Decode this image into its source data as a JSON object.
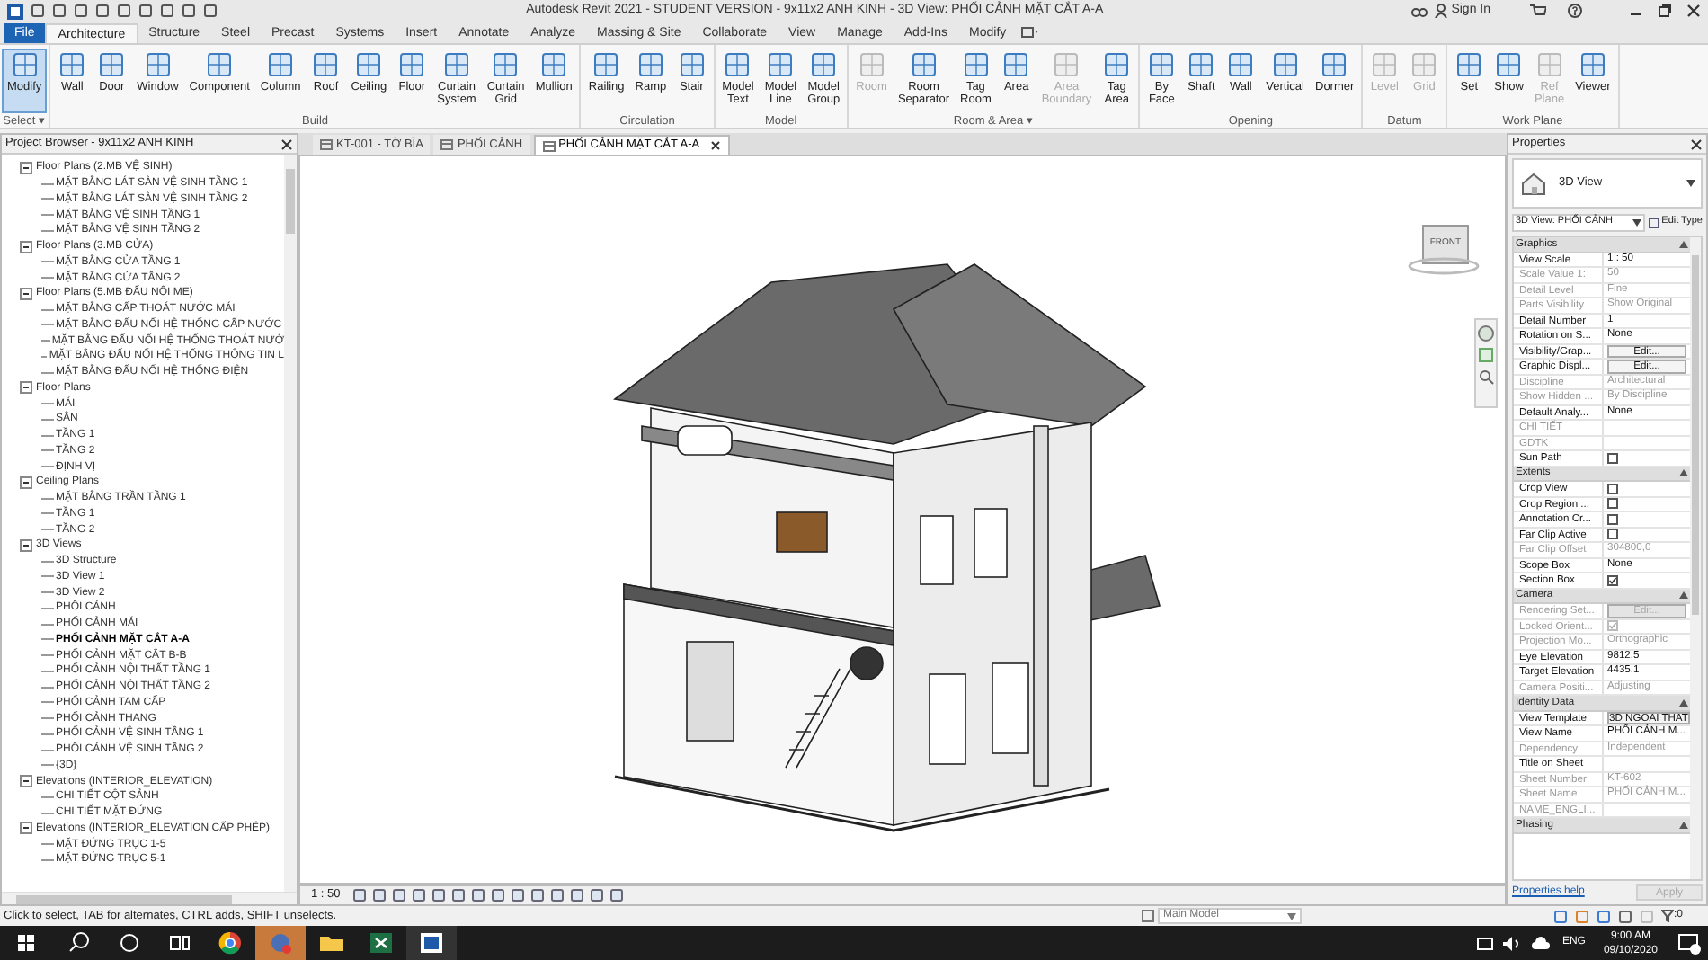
{
  "title_bar": {
    "title": "Autodesk Revit 2021 - STUDENT VERSION - 9x11x2 ANH KINH - 3D View: PHỐI CẢNH MẶT CẮT A-A",
    "sign_in": "Sign In"
  },
  "ribbon_tabs": [
    {
      "label": "File",
      "kind": "file",
      "selected": false
    },
    {
      "label": "Architecture",
      "kind": "tab",
      "selected": true
    },
    {
      "label": "Structure",
      "kind": "tab",
      "selected": false
    },
    {
      "label": "Steel",
      "kind": "tab",
      "selected": false
    },
    {
      "label": "Precast",
      "kind": "tab",
      "selected": false
    },
    {
      "label": "Systems",
      "kind": "tab",
      "selected": false
    },
    {
      "label": "Insert",
      "kind": "tab",
      "selected": false
    },
    {
      "label": "Annotate",
      "kind": "tab",
      "selected": false
    },
    {
      "label": "Analyze",
      "kind": "tab",
      "selected": false
    },
    {
      "label": "Massing & Site",
      "kind": "tab",
      "selected": false
    },
    {
      "label": "Collaborate",
      "kind": "tab",
      "selected": false
    },
    {
      "label": "View",
      "kind": "tab",
      "selected": false
    },
    {
      "label": "Manage",
      "kind": "tab",
      "selected": false
    },
    {
      "label": "Add-Ins",
      "kind": "tab",
      "selected": false
    },
    {
      "label": "Modify",
      "kind": "tab",
      "selected": false
    }
  ],
  "ribbon_panels": [
    {
      "label": "Select ▾",
      "tools": [
        {
          "label": "Modify",
          "selected": true,
          "disabled": false
        }
      ]
    },
    {
      "label": "Build",
      "tools": [
        {
          "label": "Wall",
          "selected": false,
          "disabled": false
        },
        {
          "label": "Door",
          "selected": false,
          "disabled": false
        },
        {
          "label": "Window",
          "selected": false,
          "disabled": false
        },
        {
          "label": "Component",
          "selected": false,
          "disabled": false
        },
        {
          "label": "Column",
          "selected": false,
          "disabled": false
        },
        {
          "label": "Roof",
          "selected": false,
          "disabled": false
        },
        {
          "label": "Ceiling",
          "selected": false,
          "disabled": false
        },
        {
          "label": "Floor",
          "selected": false,
          "disabled": false
        },
        {
          "label": "Curtain System",
          "selected": false,
          "disabled": false
        },
        {
          "label": "Curtain Grid",
          "selected": false,
          "disabled": false
        },
        {
          "label": "Mullion",
          "selected": false,
          "disabled": false
        }
      ]
    },
    {
      "label": "Circulation",
      "tools": [
        {
          "label": "Railing",
          "selected": false,
          "disabled": false
        },
        {
          "label": "Ramp",
          "selected": false,
          "disabled": false
        },
        {
          "label": "Stair",
          "selected": false,
          "disabled": false
        }
      ]
    },
    {
      "label": "Model",
      "tools": [
        {
          "label": "Model Text",
          "selected": false,
          "disabled": false
        },
        {
          "label": "Model Line",
          "selected": false,
          "disabled": false
        },
        {
          "label": "Model Group",
          "selected": false,
          "disabled": false
        }
      ]
    },
    {
      "label": "Room & Area ▾",
      "tools": [
        {
          "label": "Room",
          "selected": false,
          "disabled": true
        },
        {
          "label": "Room Separator",
          "selected": false,
          "disabled": false
        },
        {
          "label": "Tag Room",
          "selected": false,
          "disabled": false
        },
        {
          "label": "Area",
          "selected": false,
          "disabled": false
        },
        {
          "label": "Area Boundary",
          "selected": false,
          "disabled": true
        },
        {
          "label": "Tag Area",
          "selected": false,
          "disabled": false
        }
      ]
    },
    {
      "label": "Opening",
      "tools": [
        {
          "label": "By Face",
          "selected": false,
          "disabled": false
        },
        {
          "label": "Shaft",
          "selected": false,
          "disabled": false
        },
        {
          "label": "Wall",
          "selected": false,
          "disabled": false
        },
        {
          "label": "Vertical",
          "selected": false,
          "disabled": false
        },
        {
          "label": "Dormer",
          "selected": false,
          "disabled": false
        }
      ]
    },
    {
      "label": "Datum",
      "tools": [
        {
          "label": "Level",
          "selected": false,
          "disabled": true
        },
        {
          "label": "Grid",
          "selected": false,
          "disabled": true
        }
      ]
    },
    {
      "label": "Work Plane",
      "tools": [
        {
          "label": "Set",
          "selected": false,
          "disabled": false
        },
        {
          "label": "Show",
          "selected": false,
          "disabled": false
        },
        {
          "label": "Ref Plane",
          "selected": false,
          "disabled": true
        },
        {
          "label": "Viewer",
          "selected": false,
          "disabled": false
        }
      ]
    }
  ],
  "project_browser": {
    "title": "Project Browser - 9x11x2 ANH KINH",
    "tree": [
      {
        "label": "Floor Plans (2.MB VỆ SINH)",
        "selected": false,
        "children": [
          {
            "label": "MẶT BẰNG LÁT SÀN VỆ SINH TẦNG 1",
            "selected": false
          },
          {
            "label": "MẶT BẰNG LÁT SÀN VỆ SINH TẦNG 2",
            "selected": false
          },
          {
            "label": "MẶT BẰNG VỆ SINH TẦNG 1",
            "selected": false
          },
          {
            "label": "MẶT BẰNG VỆ SINH TẦNG 2",
            "selected": false
          }
        ]
      },
      {
        "label": "Floor Plans (3.MB CỬA)",
        "selected": false,
        "children": [
          {
            "label": "MẶT BẰNG CỬA TẦNG 1",
            "selected": false
          },
          {
            "label": "MẶT BẰNG CỬA TẦNG 2",
            "selected": false
          }
        ]
      },
      {
        "label": "Floor Plans (5.MB ĐẤU NỐI ME)",
        "selected": false,
        "children": [
          {
            "label": "MẶT BẰNG CẤP THOÁT NƯỚC MÁI",
            "selected": false
          },
          {
            "label": "MẶT BẰNG ĐẤU NỐI HỆ THỐNG CẤP NƯỚC",
            "selected": false
          },
          {
            "label": "MẶT BẰNG ĐẤU NỐI HỆ THỐNG THOÁT NƯỚ",
            "selected": false
          },
          {
            "label": "MẶT BẰNG ĐẤU NỐI HỆ THỐNG THÔNG TIN L",
            "selected": false
          },
          {
            "label": "MẶT BẰNG ĐẤU NỐI HỆ THỐNG ĐIỆN",
            "selected": false
          }
        ]
      },
      {
        "label": "Floor Plans",
        "selected": false,
        "children": [
          {
            "label": "MÁI",
            "selected": false
          },
          {
            "label": "SÂN",
            "selected": false
          },
          {
            "label": "TẦNG 1",
            "selected": false
          },
          {
            "label": "TẦNG 2",
            "selected": false
          },
          {
            "label": "ĐỊNH VỊ",
            "selected": false
          }
        ]
      },
      {
        "label": "Ceiling Plans",
        "selected": false,
        "children": [
          {
            "label": "MẶT BẰNG TRẦN TẦNG 1",
            "selected": false
          },
          {
            "label": "TẦNG 1",
            "selected": false
          },
          {
            "label": "TẦNG 2",
            "selected": false
          }
        ]
      },
      {
        "label": "3D Views",
        "selected": false,
        "children": [
          {
            "label": "3D Structure",
            "selected": false
          },
          {
            "label": "3D View 1",
            "selected": false
          },
          {
            "label": "3D View 2",
            "selected": false
          },
          {
            "label": "PHỐI CẢNH",
            "selected": false
          },
          {
            "label": "PHỐI CẢNH MÁI",
            "selected": false
          },
          {
            "label": "PHỐI CẢNH MẶT CẮT A-A",
            "selected": true
          },
          {
            "label": "PHỐI CẢNH MẶT CẮT B-B",
            "selected": false
          },
          {
            "label": "PHỐI CẢNH NỘI THẤT TẦNG 1",
            "selected": false
          },
          {
            "label": "PHỐI CẢNH NỘI THẤT TẦNG 2",
            "selected": false
          },
          {
            "label": "PHỐI CẢNH TAM CẤP",
            "selected": false
          },
          {
            "label": "PHỐI CẢNH THANG",
            "selected": false
          },
          {
            "label": "PHỐI CẢNH VỆ SINH TẦNG 1",
            "selected": false
          },
          {
            "label": "PHỐI CẢNH VỆ SINH TẦNG 2",
            "selected": false
          },
          {
            "label": "{3D}",
            "selected": false
          }
        ]
      },
      {
        "label": "Elevations (INTERIOR_ELEVATION)",
        "selected": false,
        "children": [
          {
            "label": "CHI TIẾT CỘT SẢNH",
            "selected": false
          },
          {
            "label": "CHI TIẾT MẶT ĐỨNG",
            "selected": false
          }
        ]
      },
      {
        "label": "Elevations (INTERIOR_ELEVATION CẤP PHÉP)",
        "selected": false,
        "children": [
          {
            "label": "MẶT ĐỨNG TRỤC 1-5",
            "selected": false
          },
          {
            "label": "MẶT ĐỨNG TRỤC 5-1",
            "selected": false
          }
        ]
      }
    ]
  },
  "view_tabs": [
    {
      "label": "KT-001 - TỜ BÌA",
      "selected": false
    },
    {
      "label": "PHỐI CẢNH",
      "selected": false
    },
    {
      "label": "PHỐI CẢNH MẶT CẮT A-A",
      "selected": true
    }
  ],
  "view": {
    "viewcube_label": "FRONT",
    "scale": "1 : 50"
  },
  "properties": {
    "title": "Properties",
    "type_name": "3D View",
    "instance": "3D View: PHỐI CẢNH",
    "edit_type": "Edit Type",
    "sections": [
      {
        "title": "Graphics",
        "rows": [
          {
            "label": "View Scale",
            "kind": "text",
            "value": "1 : 50",
            "disabled": false
          },
          {
            "label": "Scale Value    1:",
            "kind": "text",
            "value": "50",
            "disabled": true
          },
          {
            "label": "Detail Level",
            "kind": "text",
            "value": "Fine",
            "disabled": true
          },
          {
            "label": "Parts Visibility",
            "kind": "text",
            "value": "Show Original",
            "disabled": true
          },
          {
            "label": "Detail Number",
            "kind": "text",
            "value": "1",
            "disabled": false
          },
          {
            "label": "Rotation on S...",
            "kind": "text",
            "value": "None",
            "disabled": false
          },
          {
            "label": "Visibility/Grap...",
            "kind": "button",
            "value": "Edit...",
            "disabled": false
          },
          {
            "label": "Graphic Displ...",
            "kind": "button",
            "value": "Edit...",
            "disabled": false
          },
          {
            "label": "Discipline",
            "kind": "text",
            "value": "Architectural",
            "disabled": true
          },
          {
            "label": "Show Hidden ...",
            "kind": "text",
            "value": "By Discipline",
            "disabled": true
          },
          {
            "label": "Default Analy...",
            "kind": "text",
            "value": "None",
            "disabled": false
          },
          {
            "label": "CHI TIẾT",
            "kind": "text",
            "disabled": true
          },
          {
            "label": "GDTK",
            "kind": "text",
            "disabled": true
          },
          {
            "label": "Sun Path",
            "kind": "checkbox",
            "checked": false,
            "disabled": false
          }
        ]
      },
      {
        "title": "Extents",
        "rows": [
          {
            "label": "Crop View",
            "kind": "checkbox",
            "checked": false,
            "disabled": false
          },
          {
            "label": "Crop Region ...",
            "kind": "checkbox",
            "checked": false,
            "disabled": false
          },
          {
            "label": "Annotation Cr...",
            "kind": "checkbox",
            "checked": false,
            "disabled": false
          },
          {
            "label": "Far Clip Active",
            "kind": "checkbox",
            "checked": false,
            "disabled": false
          },
          {
            "label": "Far Clip Offset",
            "kind": "text",
            "value": "304800,0",
            "disabled": true
          },
          {
            "label": "Scope Box",
            "kind": "text",
            "value": "None",
            "disabled": false
          },
          {
            "label": "Section Box",
            "kind": "checkbox",
            "checked": true,
            "disabled": false
          }
        ]
      },
      {
        "title": "Camera",
        "rows": [
          {
            "label": "Rendering Set...",
            "kind": "button",
            "value": "Edit...",
            "disabled": true
          },
          {
            "label": "Locked Orient...",
            "kind": "checkbox",
            "checked": true,
            "disabled": true
          },
          {
            "label": "Projection Mo...",
            "kind": "text",
            "value": "Orthographic",
            "disabled": true
          },
          {
            "label": "Eye Elevation",
            "kind": "text",
            "value": "9812,5",
            "disabled": false
          },
          {
            "label": "Target Elevation",
            "kind": "text",
            "value": "4435,1",
            "disabled": false
          },
          {
            "label": "Camera Positi...",
            "kind": "text",
            "value": "Adjusting",
            "disabled": true
          }
        ]
      },
      {
        "title": "Identity Data",
        "rows": [
          {
            "label": "View Template",
            "kind": "button",
            "value": "3D NGOAI THAT",
            "disabled": false
          },
          {
            "label": "View Name",
            "kind": "text",
            "value": "PHỐI CẢNH M...",
            "disabled": false
          },
          {
            "label": "Dependency",
            "kind": "text",
            "value": "Independent",
            "disabled": true
          },
          {
            "label": "Title on Sheet",
            "kind": "text",
            "disabled": false
          },
          {
            "label": "Sheet Number",
            "kind": "text",
            "value": "KT-602",
            "disabled": true
          },
          {
            "label": "Sheet Name",
            "kind": "text",
            "value": "PHỐI CẢNH M...",
            "disabled": true
          },
          {
            "label": "NAME_ENGLI...",
            "kind": "text",
            "disabled": true
          }
        ]
      },
      {
        "title": "Phasing"
      }
    ],
    "help": "Properties help",
    "apply": "Apply"
  },
  "status_bar": {
    "message": "Click to select, TAB for alternates, CTRL adds, SHIFT unselects.",
    "model": "Main Model",
    "filter_count": ":0"
  },
  "taskbar": {
    "language": "ENG",
    "time": "9:00 AM",
    "date": "09/10/2020"
  }
}
